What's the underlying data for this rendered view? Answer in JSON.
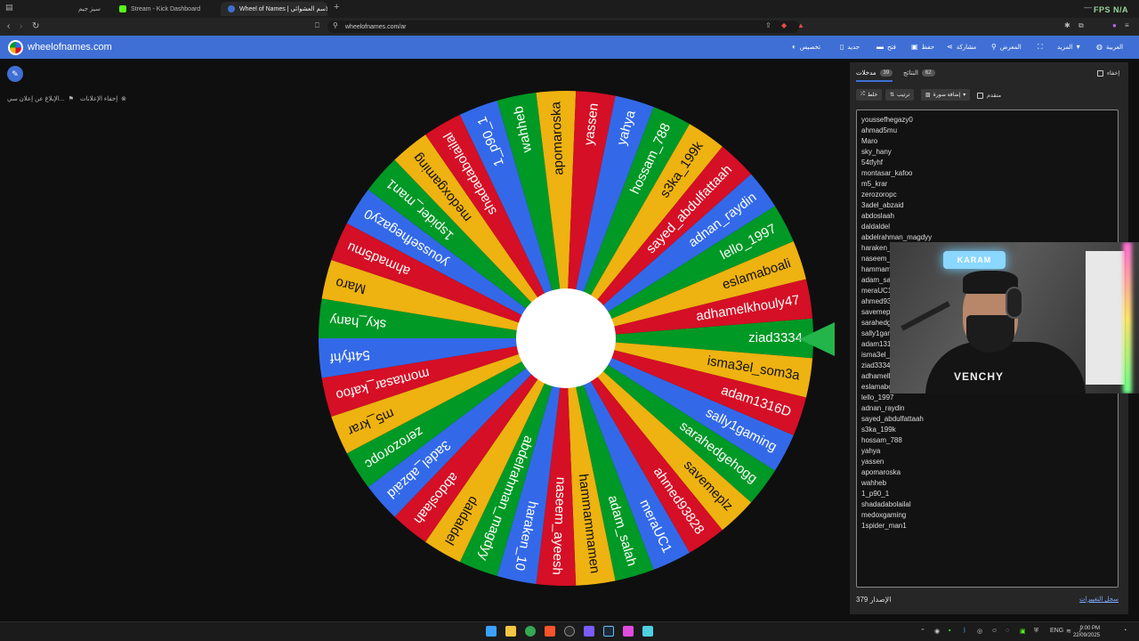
{
  "browser": {
    "tabs": [
      {
        "label": "سيز جيم",
        "icon_color": "#e84a4a"
      },
      {
        "label": "Stream - Kick Dashboard",
        "icon_color": "#53fc18"
      },
      {
        "label": "Wheel of Names | الاسم العشوائي",
        "icon_color": "#3f6fd4"
      }
    ],
    "new_tab": "+",
    "fps_label": "FPS N/A",
    "url": "wheelofnames.com/ar"
  },
  "header": {
    "brand": "wheelofnames.com",
    "menu": [
      {
        "label": "تخصيص",
        "icon": "palette-icon"
      },
      {
        "label": "جديد",
        "icon": "new-file-icon"
      },
      {
        "label": "فتح",
        "icon": "folder-icon"
      },
      {
        "label": "حفظ",
        "icon": "save-icon"
      },
      {
        "label": "مشاركة",
        "icon": "share-icon"
      },
      {
        "label": "المعرض",
        "icon": "search-icon"
      },
      {
        "label": "",
        "icon": "fullscreen-icon"
      },
      {
        "label": "المزيد",
        "icon": "chevron-down-icon"
      },
      {
        "label": "العربية",
        "icon": "globe-icon"
      }
    ]
  },
  "left": {
    "ad_links": [
      {
        "label": "الإبلاغ عن إعلان سي...",
        "icon": "flag-icon"
      },
      {
        "label": "إخفاء الإعلانات",
        "icon": "close-circle-icon"
      }
    ]
  },
  "wheel": {
    "colors": [
      "#3369e8",
      "#d50f25",
      "#eeb211",
      "#009925"
    ],
    "pointer_color": "#23b54a",
    "segments": [
      "ziad3334",
      "isma3el_som3a",
      "adam1316D",
      "sally1gaming",
      "sarahedgehogg",
      "savemeplz",
      "ahmed93828",
      "meraUC1",
      "adam_salah",
      "hammammamen",
      "naseem_ayeesh",
      "haraken_10",
      "abdelrahman_magdyy",
      "daldaldel",
      "abdoslaah",
      "3adel_abzaid",
      "zerozoropc",
      "m5_krar",
      "montasar_kafoo",
      "54tfyhf",
      "sky_hany",
      "Maro",
      "ahmad5mu",
      "youssefhegazy0",
      "1spider_man1",
      "medoxgaming",
      "shadadabolailal",
      "1_p90_1",
      "wahheb",
      "apomaroska",
      "yassen",
      "yahya",
      "hossam_788",
      "s3ka_199k",
      "sayed_abdulfattaah",
      "adnan_raydin",
      "lello_1997",
      "eslamaboali",
      "adhamelkhouly47"
    ]
  },
  "panel": {
    "tabs": [
      {
        "label": "مدخلات",
        "count": "39"
      },
      {
        "label": "النتائج",
        "count": "62"
      }
    ],
    "hide_label": "إخفاء",
    "buttons": [
      {
        "label": "خلط",
        "icon": "shuffle-icon"
      },
      {
        "label": "ترتيب",
        "icon": "sort-icon"
      },
      {
        "label": "إضافة صورة",
        "icon": "image-icon"
      }
    ],
    "advanced_label": "متقدم",
    "entries": [
      "youssefhegazy0",
      "ahmad5mu",
      "Maro",
      "sky_hany",
      "54tfyhf",
      "montasar_kafoo",
      "m5_krar",
      "zerozoropc",
      "3adel_abzaid",
      "abdoslaah",
      "daldaldel",
      "abdelrahman_magdyy",
      "haraken_10",
      "naseem_ayeesh",
      "hammammamen",
      "adam_salah",
      "meraUC1",
      "ahmed93828",
      "savemeplz",
      "sarahedgehogg",
      "sally1gaming",
      "adam1316D",
      "isma3el_som3a",
      "ziad3334",
      "adhamelkhouly47",
      "eslamaboali",
      "lello_1997",
      "adnan_raydin",
      "sayed_abdulfattaah",
      "s3ka_199k",
      "hossam_788",
      "yahya",
      "yassen",
      "apomaroska",
      "wahheb",
      "1_p90_1",
      "shadadabolailal",
      "medoxgaming",
      "1spider_man1"
    ],
    "footer_count": "379 الإصدار",
    "history_link": "سجل التغييرات"
  },
  "webcam": {
    "sign_text": "KARAM",
    "shirt_text": "VENCHY"
  },
  "taskbar": {
    "lang": "ENG",
    "time": "9:00 PM",
    "date": "22/09/2025"
  }
}
